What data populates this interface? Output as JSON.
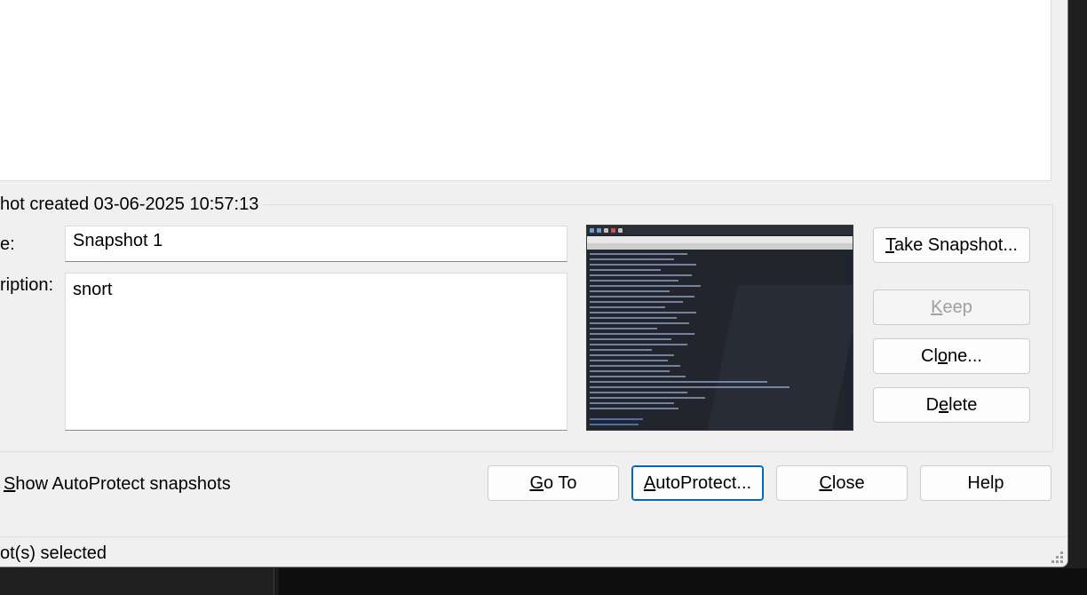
{
  "group": {
    "title": "hot created 03-06-2025 10:57:13"
  },
  "form": {
    "name_label": "e:",
    "name_value": "Snapshot 1",
    "description_label": "ription:",
    "description_value": "snort"
  },
  "side_buttons": {
    "take_snapshot_pre": "",
    "take_snapshot_key": "T",
    "take_snapshot_post": "ake Snapshot...",
    "keep_key": "K",
    "keep_post": "eep",
    "clone_pre": "Cl",
    "clone_key": "o",
    "clone_post": "ne...",
    "delete_pre": "D",
    "delete_key": "e",
    "delete_post": "lete"
  },
  "bottom": {
    "checkbox_key": "S",
    "checkbox_post": "how AutoProtect snapshots",
    "goto_key": "G",
    "goto_post": "o To",
    "autoprotect_key": "A",
    "autoprotect_post": "utoProtect...",
    "close_key": "C",
    "close_post": "lose",
    "help_label": "Help"
  },
  "status": {
    "text": "ot(s) selected"
  }
}
